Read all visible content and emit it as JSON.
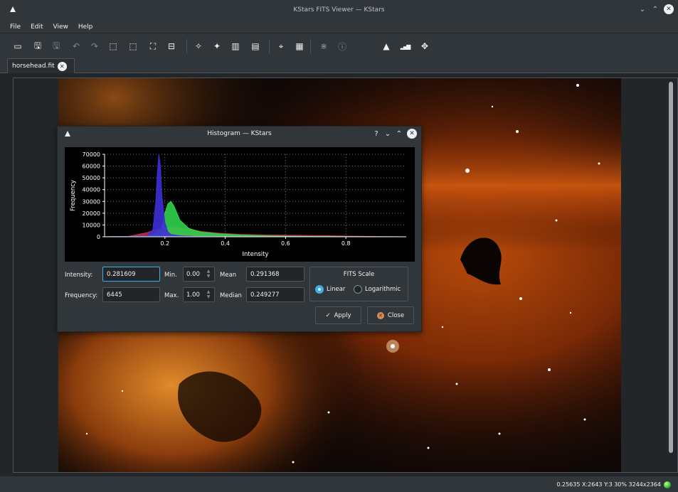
{
  "window": {
    "title": "KStars FITS Viewer — KStars"
  },
  "menu": [
    "File",
    "Edit",
    "View",
    "Help"
  ],
  "toolbar": [
    {
      "name": "open-icon",
      "glyph": "▭",
      "enabled": true
    },
    {
      "name": "save-icon",
      "glyph": "🖫",
      "enabled": true
    },
    {
      "name": "save-as-icon",
      "glyph": "🖫",
      "enabled": false
    },
    {
      "name": "undo-icon",
      "glyph": "↶",
      "enabled": false
    },
    {
      "name": "redo-icon",
      "glyph": "↷",
      "enabled": false
    },
    {
      "name": "zoom-in-icon",
      "glyph": "⬚",
      "enabled": true
    },
    {
      "name": "zoom-out-icon",
      "glyph": "⬚",
      "enabled": true
    },
    {
      "name": "zoom-fit-icon",
      "glyph": "⛶",
      "enabled": true
    },
    {
      "name": "zoom-original-icon",
      "glyph": "⊟",
      "enabled": true
    },
    {
      "name": "mark-stars-icon",
      "glyph": "✧",
      "enabled": true
    },
    {
      "name": "star-profile-icon",
      "glyph": "✦",
      "enabled": true
    },
    {
      "name": "statistics-icon",
      "glyph": "▥",
      "enabled": true
    },
    {
      "name": "header-icon",
      "glyph": "▤",
      "enabled": true
    },
    {
      "name": "crosshair-icon",
      "glyph": "⌖",
      "enabled": true
    },
    {
      "name": "grid-icon",
      "glyph": "▦",
      "enabled": true
    },
    {
      "name": "eq-grid-icon",
      "glyph": "⋇",
      "enabled": false
    },
    {
      "name": "info-icon",
      "glyph": "ⓘ",
      "enabled": false
    },
    {
      "name": "histogram-icon",
      "glyph": "▲",
      "enabled": true
    },
    {
      "name": "levels-icon",
      "glyph": "▂▄▆",
      "enabled": true
    },
    {
      "name": "center-icon",
      "glyph": "✥",
      "enabled": true
    }
  ],
  "tab": {
    "label": "horsehead.fit"
  },
  "status": {
    "text": "0.25635  X:2643 Y:3  30%  3244x2364"
  },
  "histogram": {
    "title": "Histogram — KStars",
    "intensity_label": "Intensity:",
    "intensity_value": "0.281609",
    "frequency_label": "Frequency:",
    "frequency_value": "6445",
    "min_label": "Min.",
    "min_value": "0.00",
    "max_label": "Max.",
    "max_value": "1.00",
    "mean_label": "Mean",
    "mean_value": "0.291368",
    "median_label": "Median",
    "median_value": "0.249277",
    "scale_group": "FITS Scale",
    "linear_label": "Linear",
    "log_label": "Logarithmic",
    "apply_label": "Apply",
    "close_label": "Close",
    "selected_scale": "Linear"
  },
  "chart_data": {
    "type": "area",
    "xlabel": "Intensity",
    "ylabel": "Frequency",
    "xlim": [
      0,
      1
    ],
    "ylim": [
      0,
      70000
    ],
    "xticks": [
      "0.2",
      "0.4",
      "0.6",
      "0.8"
    ],
    "yticks": [
      "0",
      "10000",
      "20000",
      "30000",
      "40000",
      "50000",
      "60000",
      "70000"
    ],
    "grid": true,
    "series": [
      {
        "color": "#c0294a",
        "x": [
          0.0,
          0.08,
          0.14,
          0.17,
          0.2,
          0.24,
          0.28,
          0.32,
          0.38,
          0.45,
          0.55,
          0.65,
          0.75,
          0.85,
          0.95,
          1.0
        ],
        "y": [
          0,
          400,
          3500,
          6000,
          7500,
          8000,
          6500,
          4500,
          3000,
          2000,
          1500,
          1200,
          800,
          400,
          100,
          0
        ]
      },
      {
        "color": "#2ed34a",
        "x": [
          0.0,
          0.14,
          0.17,
          0.19,
          0.2,
          0.21,
          0.22,
          0.23,
          0.25,
          0.28,
          0.32,
          0.38,
          0.45,
          0.55,
          0.7,
          1.0
        ],
        "y": [
          0,
          500,
          3000,
          8000,
          20000,
          28000,
          30000,
          26000,
          14000,
          7000,
          4000,
          2500,
          1500,
          700,
          200,
          0
        ]
      },
      {
        "color": "#3d2fd6",
        "x": [
          0.0,
          0.14,
          0.16,
          0.17,
          0.175,
          0.18,
          0.185,
          0.19,
          0.2,
          0.21,
          0.22,
          0.25,
          0.3,
          0.4,
          0.6,
          1.0
        ],
        "y": [
          0,
          600,
          6000,
          30000,
          55000,
          70000,
          60000,
          35000,
          12000,
          4000,
          2000,
          800,
          300,
          100,
          0,
          0
        ]
      }
    ]
  }
}
